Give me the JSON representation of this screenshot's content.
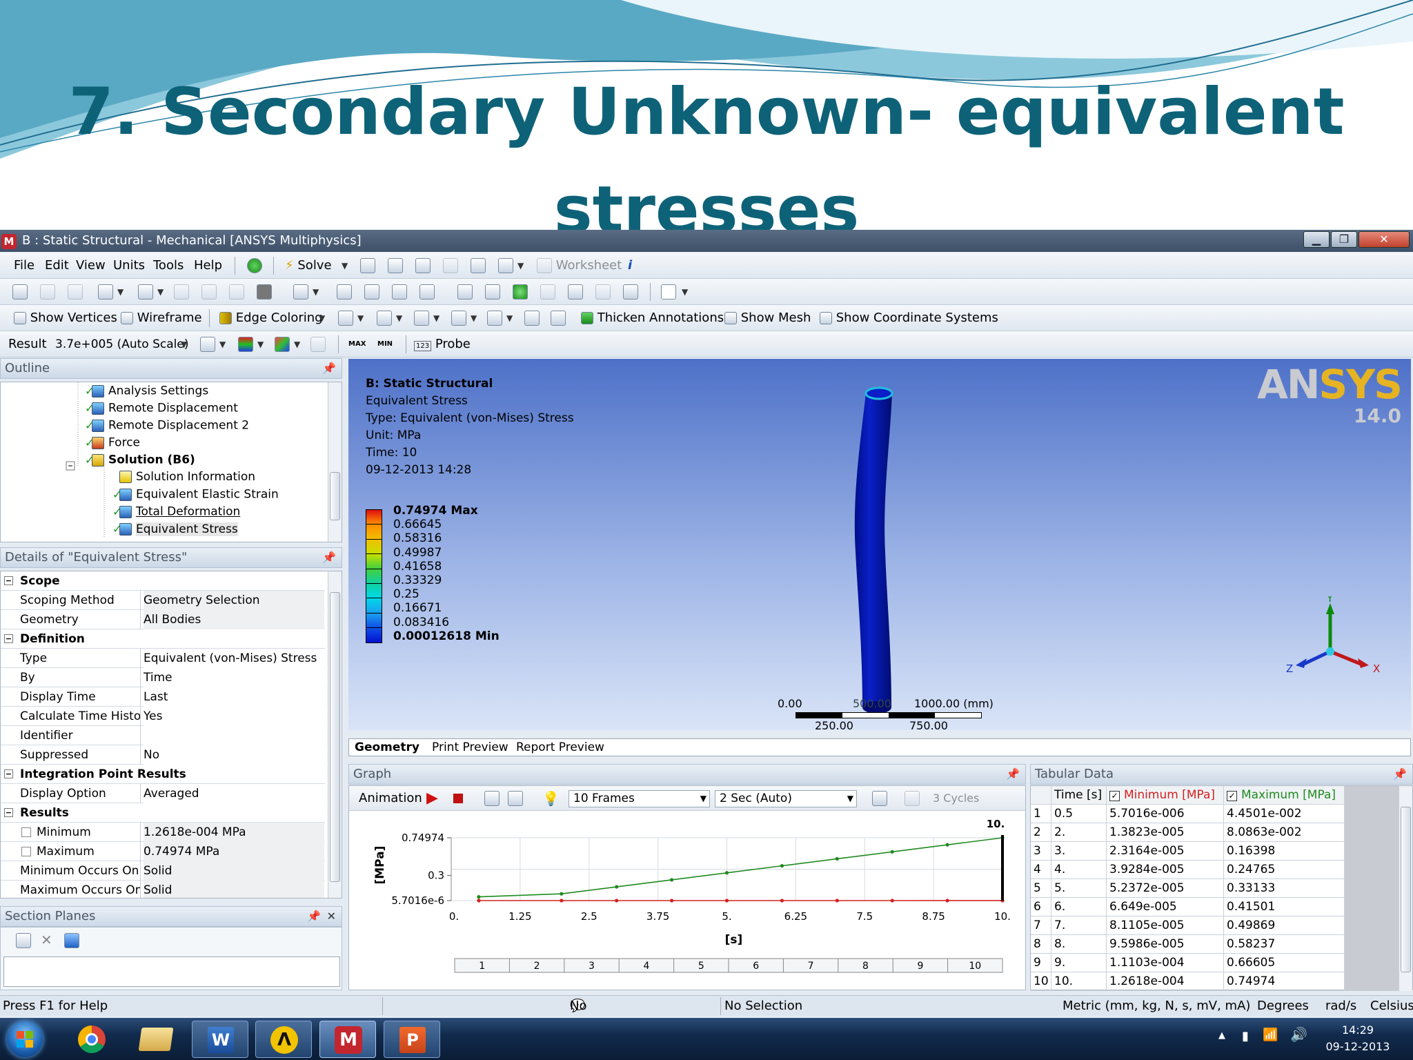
{
  "slide": {
    "title_line1": "7. Secondary Unknown- equivalent",
    "title_line2": "stresses"
  },
  "window": {
    "title": "B : Static Structural - Mechanical [ANSYS Multiphysics]",
    "min": "▁",
    "max": "❐",
    "close": "✕"
  },
  "menu": [
    "File",
    "Edit",
    "View",
    "Units",
    "Tools",
    "Help"
  ],
  "toolbar1": {
    "solve": "Solve",
    "worksheet": "Worksheet",
    "info": "i"
  },
  "toolbar3": {
    "show_vertices": "Show Vertices",
    "wireframe": "Wireframe",
    "edge_coloring": "Edge Coloring",
    "thicken": "Thicken Annotations",
    "show_mesh": "Show Mesh",
    "show_coords": "Show Coordinate Systems"
  },
  "toolbar4": {
    "result_label": "Result",
    "scale": "3.7e+005 (Auto Scale)",
    "max": "MAX",
    "min": "MIN",
    "probe_icon": "123",
    "probe": "Probe"
  },
  "outline": {
    "header": "Outline",
    "items": [
      {
        "label": "Analysis Settings"
      },
      {
        "label": "Remote Displacement"
      },
      {
        "label": "Remote Displacement 2"
      },
      {
        "label": "Force"
      },
      {
        "label": "Solution (B6)"
      },
      {
        "label": "Solution Information"
      },
      {
        "label": "Equivalent Elastic Strain"
      },
      {
        "label": "Total Deformation"
      },
      {
        "label": "Equivalent Stress"
      }
    ]
  },
  "details": {
    "header": "Details of \"Equivalent Stress\"",
    "rows": [
      {
        "k": "Scope",
        "v": ""
      },
      {
        "k": "Scoping Method",
        "v": "Geometry Selection"
      },
      {
        "k": "Geometry",
        "v": "All Bodies"
      },
      {
        "k": "Definition",
        "v": ""
      },
      {
        "k": "Type",
        "v": "Equivalent (von-Mises) Stress"
      },
      {
        "k": "By",
        "v": "Time"
      },
      {
        "k": "Display Time",
        "v": "Last"
      },
      {
        "k": "Calculate Time History",
        "v": "Yes"
      },
      {
        "k": "Identifier",
        "v": ""
      },
      {
        "k": "Suppressed",
        "v": "No"
      },
      {
        "k": "Integration Point Results",
        "v": ""
      },
      {
        "k": "Display Option",
        "v": "Averaged"
      },
      {
        "k": "Results",
        "v": ""
      },
      {
        "k": "Minimum",
        "v": "1.2618e-004 MPa"
      },
      {
        "k": "Maximum",
        "v": "0.74974 MPa"
      },
      {
        "k": "Minimum Occurs On",
        "v": "Solid"
      },
      {
        "k": "Maximum Occurs On",
        "v": "Solid"
      }
    ]
  },
  "section_planes": {
    "header": "Section Planes",
    "close": "✕"
  },
  "viewport": {
    "info": [
      "B: Static Structural",
      "Equivalent Stress",
      "Type: Equivalent (von-Mises) Stress",
      "Unit: MPa",
      "Time: 10",
      "09-12-2013 14:28"
    ],
    "logo_main": "AN",
    "logo_accent": "SYS",
    "version": "14.0",
    "legend": [
      "0.74974 Max",
      "0.66645",
      "0.58316",
      "0.49987",
      "0.41658",
      "0.33329",
      "0.25",
      "0.16671",
      "0.083416",
      "0.00012618 Min"
    ],
    "legend_colors": [
      "#e01010",
      "#ff8c00",
      "#f0c000",
      "#c8e000",
      "#40d040",
      "#10d0a0",
      "#00d8e8",
      "#1aa0f0",
      "#1050e8",
      "#0010d0"
    ],
    "scale": {
      "l0": "0.00",
      "l1": "1000.00 (mm)",
      "l2": "250.00",
      "l3": "750.00",
      "mid": "500.00"
    },
    "triad": {
      "y": "Y",
      "z": "Z",
      "x": "X"
    }
  },
  "view_tabs": [
    "Geometry",
    "Print Preview",
    "Report Preview"
  ],
  "graph": {
    "header": "Graph",
    "animation": "Animation",
    "frames": "10 Frames",
    "sec": "2 Sec (Auto)",
    "cycles": "3 Cycles",
    "ylabel": "[MPa]",
    "xlabel": "[s]",
    "ytick_labels": [
      "0.74974",
      "0.3",
      "5.7016e-6"
    ],
    "xtick_labels": [
      "0.",
      "1.25",
      "2.5",
      "3.75",
      "5.",
      "6.25",
      "7.5",
      "8.75",
      "10."
    ],
    "top_label": "10.",
    "frame_numbers": [
      "1",
      "2",
      "3",
      "4",
      "5",
      "6",
      "7",
      "8",
      "9",
      "10"
    ]
  },
  "tabular": {
    "header": "Tabular Data",
    "columns": [
      "Time [s]",
      "Minimum [MPa]",
      "Maximum [MPa]"
    ],
    "rows": [
      [
        "1",
        "0.5",
        "5.7016e-006",
        "4.4501e-002"
      ],
      [
        "2",
        "2.",
        "1.3823e-005",
        "8.0863e-002"
      ],
      [
        "3",
        "3.",
        "2.3164e-005",
        "0.16398"
      ],
      [
        "4",
        "4.",
        "3.9284e-005",
        "0.24765"
      ],
      [
        "5",
        "5.",
        "5.2372e-005",
        "0.33133"
      ],
      [
        "6",
        "6.",
        "6.649e-005",
        "0.41501"
      ],
      [
        "7",
        "7.",
        "8.1105e-005",
        "0.49869"
      ],
      [
        "8",
        "8.",
        "9.5986e-005",
        "0.58237"
      ],
      [
        "9",
        "9.",
        "1.1103e-004",
        "0.66605"
      ],
      [
        "10",
        "10.",
        "1.2618e-004",
        "0.74974"
      ]
    ]
  },
  "chart_data": {
    "type": "line",
    "x": [
      0.5,
      2,
      3,
      4,
      5,
      6,
      7,
      8,
      9,
      10
    ],
    "series": [
      {
        "name": "Minimum [MPa]",
        "values": [
          5.7016e-06,
          1.3823e-05,
          2.3164e-05,
          3.9284e-05,
          5.2372e-05,
          6.649e-05,
          8.1105e-05,
          9.5986e-05,
          0.00011103,
          0.00012618
        ],
        "color": "#d42020"
      },
      {
        "name": "Maximum [MPa]",
        "values": [
          0.044501,
          0.080863,
          0.16398,
          0.24765,
          0.33133,
          0.41501,
          0.49869,
          0.58237,
          0.66605,
          0.74974
        ],
        "color": "#1f8a1f"
      }
    ],
    "xlabel": "[s]",
    "ylabel": "[MPa]",
    "xlim": [
      0,
      10
    ],
    "ylim": [
      5.7016e-06,
      0.74974
    ]
  },
  "status": {
    "help": "Press F1 for Help",
    "messages": "No Messages",
    "selection": "No Selection",
    "units": "Metric (mm, kg, N, s, mV, mA)",
    "deg": "Degrees",
    "rad": "rad/s",
    "temp": "Celsius"
  },
  "taskbar": {
    "time": "14:29",
    "date": "09-12-2013"
  }
}
